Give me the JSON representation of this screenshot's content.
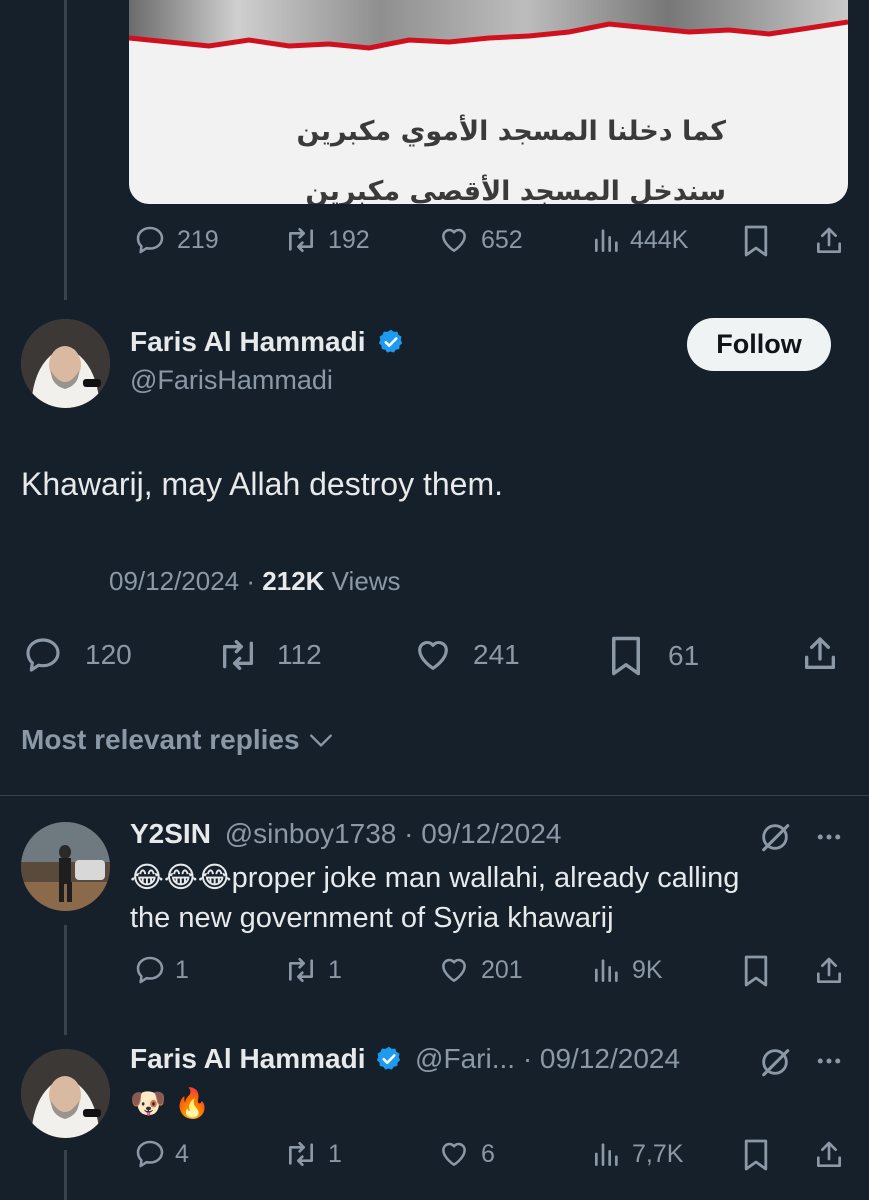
{
  "media": {
    "line1": "كما دخلنا المسجد الأموي مكبرين",
    "line2": "سندخل المسجد الأقصى مكبرين"
  },
  "quoted_tweet": {
    "replies": "219",
    "reposts": "192",
    "likes": "652",
    "views": "444K"
  },
  "main_tweet": {
    "author_name": "Faris Al Hammadi",
    "author_handle": "@FarisHammadi",
    "follow_label": "Follow",
    "text": "Khawarij, may Allah destroy them.",
    "date": "09/12/2024",
    "separator": "·",
    "views_count": "212K",
    "views_label": "Views",
    "replies": "120",
    "reposts": "112",
    "likes": "241",
    "bookmarks": "61"
  },
  "replies_filter": {
    "label": "Most relevant replies"
  },
  "reply1": {
    "author_name": "Y2SIN",
    "author_handle": "@sinboy1738",
    "date": "· 09/12/2024",
    "emojis": "😂😂😂",
    "text_line1": "proper joke man wallahi, already calling",
    "text_line2": "the new government of Syria khawarij",
    "replies": "1",
    "reposts": "1",
    "likes": "201",
    "views": "9K"
  },
  "reply2": {
    "author_name": "Faris Al Hammadi",
    "author_handle": "@Fari...",
    "date": "· 09/12/2024",
    "emojis": "🐶 🔥",
    "replies": "4",
    "reposts": "1",
    "likes": "6",
    "views": "7,7K"
  },
  "colors": {
    "background": "#15202b",
    "text": "#e7e9ea",
    "muted": "#8b98a5",
    "verified": "#1d9bf0",
    "divider": "#38444d"
  }
}
